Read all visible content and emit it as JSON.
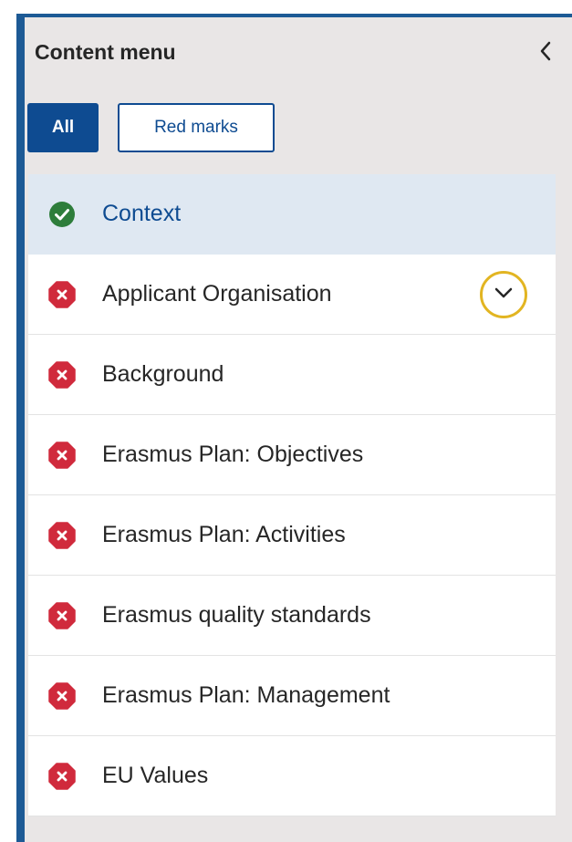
{
  "panel": {
    "title": "Content menu"
  },
  "filters": {
    "all_label": "All",
    "red_marks_label": "Red marks",
    "selected": "All"
  },
  "colors": {
    "accent": "#0e4b91",
    "panel_border": "#1d5a95",
    "panel_background": "#e9e6e6",
    "active_row": "#dfe8f2",
    "status_complete": "#2e7d3b",
    "status_error": "#d02a3c",
    "focus_ring": "#e2b522"
  },
  "menu": {
    "items": [
      {
        "label": "Context",
        "status": "complete",
        "status_icon": "check-circle-icon",
        "active": true
      },
      {
        "label": "Applicant Organisation",
        "status": "error",
        "status_icon": "error-octagon-icon",
        "active": false,
        "expand_icon": "chevron-down-icon"
      },
      {
        "label": "Background",
        "status": "error",
        "status_icon": "error-octagon-icon",
        "active": false
      },
      {
        "label": "Erasmus Plan: Objectives",
        "status": "error",
        "status_icon": "error-octagon-icon",
        "active": false
      },
      {
        "label": "Erasmus Plan: Activities",
        "status": "error",
        "status_icon": "error-octagon-icon",
        "active": false
      },
      {
        "label": "Erasmus quality standards",
        "status": "error",
        "status_icon": "error-octagon-icon",
        "active": false
      },
      {
        "label": "Erasmus Plan: Management",
        "status": "error",
        "status_icon": "error-octagon-icon",
        "active": false
      },
      {
        "label": "EU Values",
        "status": "error",
        "status_icon": "error-octagon-icon",
        "active": false
      }
    ]
  },
  "icons": {
    "collapse": "chevron-left-icon"
  }
}
